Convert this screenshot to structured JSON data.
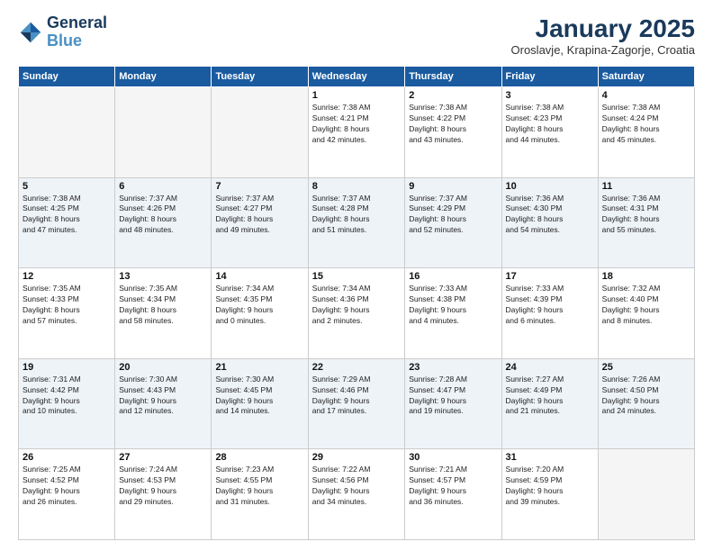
{
  "header": {
    "logo_line1": "General",
    "logo_line2": "Blue",
    "month": "January 2025",
    "location": "Oroslavje, Krapina-Zagorje, Croatia"
  },
  "weekdays": [
    "Sunday",
    "Monday",
    "Tuesday",
    "Wednesday",
    "Thursday",
    "Friday",
    "Saturday"
  ],
  "weeks": [
    [
      {
        "day": "",
        "info": ""
      },
      {
        "day": "",
        "info": ""
      },
      {
        "day": "",
        "info": ""
      },
      {
        "day": "1",
        "info": "Sunrise: 7:38 AM\nSunset: 4:21 PM\nDaylight: 8 hours\nand 42 minutes."
      },
      {
        "day": "2",
        "info": "Sunrise: 7:38 AM\nSunset: 4:22 PM\nDaylight: 8 hours\nand 43 minutes."
      },
      {
        "day": "3",
        "info": "Sunrise: 7:38 AM\nSunset: 4:23 PM\nDaylight: 8 hours\nand 44 minutes."
      },
      {
        "day": "4",
        "info": "Sunrise: 7:38 AM\nSunset: 4:24 PM\nDaylight: 8 hours\nand 45 minutes."
      }
    ],
    [
      {
        "day": "5",
        "info": "Sunrise: 7:38 AM\nSunset: 4:25 PM\nDaylight: 8 hours\nand 47 minutes."
      },
      {
        "day": "6",
        "info": "Sunrise: 7:37 AM\nSunset: 4:26 PM\nDaylight: 8 hours\nand 48 minutes."
      },
      {
        "day": "7",
        "info": "Sunrise: 7:37 AM\nSunset: 4:27 PM\nDaylight: 8 hours\nand 49 minutes."
      },
      {
        "day": "8",
        "info": "Sunrise: 7:37 AM\nSunset: 4:28 PM\nDaylight: 8 hours\nand 51 minutes."
      },
      {
        "day": "9",
        "info": "Sunrise: 7:37 AM\nSunset: 4:29 PM\nDaylight: 8 hours\nand 52 minutes."
      },
      {
        "day": "10",
        "info": "Sunrise: 7:36 AM\nSunset: 4:30 PM\nDaylight: 8 hours\nand 54 minutes."
      },
      {
        "day": "11",
        "info": "Sunrise: 7:36 AM\nSunset: 4:31 PM\nDaylight: 8 hours\nand 55 minutes."
      }
    ],
    [
      {
        "day": "12",
        "info": "Sunrise: 7:35 AM\nSunset: 4:33 PM\nDaylight: 8 hours\nand 57 minutes."
      },
      {
        "day": "13",
        "info": "Sunrise: 7:35 AM\nSunset: 4:34 PM\nDaylight: 8 hours\nand 58 minutes."
      },
      {
        "day": "14",
        "info": "Sunrise: 7:34 AM\nSunset: 4:35 PM\nDaylight: 9 hours\nand 0 minutes."
      },
      {
        "day": "15",
        "info": "Sunrise: 7:34 AM\nSunset: 4:36 PM\nDaylight: 9 hours\nand 2 minutes."
      },
      {
        "day": "16",
        "info": "Sunrise: 7:33 AM\nSunset: 4:38 PM\nDaylight: 9 hours\nand 4 minutes."
      },
      {
        "day": "17",
        "info": "Sunrise: 7:33 AM\nSunset: 4:39 PM\nDaylight: 9 hours\nand 6 minutes."
      },
      {
        "day": "18",
        "info": "Sunrise: 7:32 AM\nSunset: 4:40 PM\nDaylight: 9 hours\nand 8 minutes."
      }
    ],
    [
      {
        "day": "19",
        "info": "Sunrise: 7:31 AM\nSunset: 4:42 PM\nDaylight: 9 hours\nand 10 minutes."
      },
      {
        "day": "20",
        "info": "Sunrise: 7:30 AM\nSunset: 4:43 PM\nDaylight: 9 hours\nand 12 minutes."
      },
      {
        "day": "21",
        "info": "Sunrise: 7:30 AM\nSunset: 4:45 PM\nDaylight: 9 hours\nand 14 minutes."
      },
      {
        "day": "22",
        "info": "Sunrise: 7:29 AM\nSunset: 4:46 PM\nDaylight: 9 hours\nand 17 minutes."
      },
      {
        "day": "23",
        "info": "Sunrise: 7:28 AM\nSunset: 4:47 PM\nDaylight: 9 hours\nand 19 minutes."
      },
      {
        "day": "24",
        "info": "Sunrise: 7:27 AM\nSunset: 4:49 PM\nDaylight: 9 hours\nand 21 minutes."
      },
      {
        "day": "25",
        "info": "Sunrise: 7:26 AM\nSunset: 4:50 PM\nDaylight: 9 hours\nand 24 minutes."
      }
    ],
    [
      {
        "day": "26",
        "info": "Sunrise: 7:25 AM\nSunset: 4:52 PM\nDaylight: 9 hours\nand 26 minutes."
      },
      {
        "day": "27",
        "info": "Sunrise: 7:24 AM\nSunset: 4:53 PM\nDaylight: 9 hours\nand 29 minutes."
      },
      {
        "day": "28",
        "info": "Sunrise: 7:23 AM\nSunset: 4:55 PM\nDaylight: 9 hours\nand 31 minutes."
      },
      {
        "day": "29",
        "info": "Sunrise: 7:22 AM\nSunset: 4:56 PM\nDaylight: 9 hours\nand 34 minutes."
      },
      {
        "day": "30",
        "info": "Sunrise: 7:21 AM\nSunset: 4:57 PM\nDaylight: 9 hours\nand 36 minutes."
      },
      {
        "day": "31",
        "info": "Sunrise: 7:20 AM\nSunset: 4:59 PM\nDaylight: 9 hours\nand 39 minutes."
      },
      {
        "day": "",
        "info": ""
      }
    ]
  ]
}
